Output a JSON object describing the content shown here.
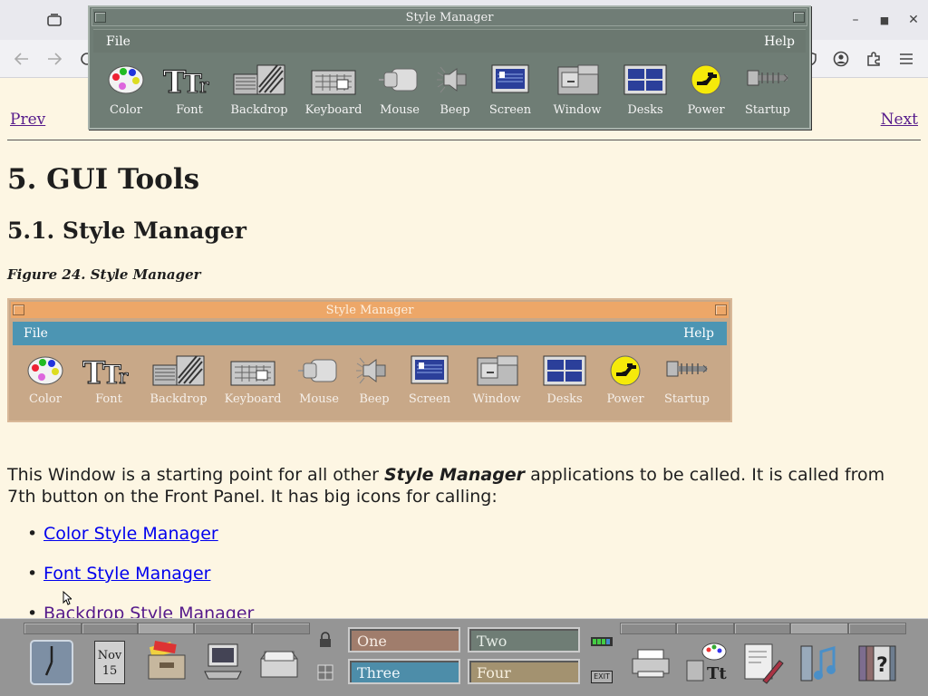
{
  "browser": {
    "window_controls": {
      "minimize": "–",
      "maximize": "■",
      "close": "✕"
    }
  },
  "page": {
    "nav": {
      "prev": "Prev",
      "next": "Next"
    },
    "heading1": "5. GUI Tools",
    "heading2": "5.1. Style Manager",
    "figure_caption": "Figure 24. Style Manager",
    "paragraph_pre": "This Window is a starting point for all other ",
    "paragraph_em": "Style Manager",
    "paragraph_post": " applications to be called. It is called from 7th button on the Front Panel. It has big icons for calling:",
    "links": [
      "Color Style Manager",
      "Font Style Manager",
      "Backdrop Style Manager"
    ]
  },
  "style_manager_window": {
    "title": "Style Manager",
    "menu": {
      "file": "File",
      "help": "Help"
    },
    "icons": [
      "Color",
      "Font",
      "Backdrop",
      "Keyboard",
      "Mouse",
      "Beep",
      "Screen",
      "Window",
      "Desks",
      "Power",
      "Startup"
    ]
  },
  "figure_window": {
    "title": "Style Manager",
    "menu": {
      "file": "File",
      "help": "Help"
    },
    "icons": [
      "Color",
      "Font",
      "Backdrop",
      "Keyboard",
      "Mouse",
      "Beep",
      "Screen",
      "Window",
      "Desks",
      "Power",
      "Startup"
    ]
  },
  "front_panel": {
    "workspaces": [
      "One",
      "Two",
      "Three",
      "Four"
    ],
    "calendar": {
      "month": "Nov",
      "day": "15"
    },
    "exit_label": "EXIT",
    "left_icons": [
      "clock-icon",
      "calendar-icon",
      "file-manager-icon",
      "terminal-icon",
      "mailer-icon"
    ],
    "right_icons": [
      "printer-icon",
      "style-manager-icon",
      "text-editor-icon",
      "audio-icon",
      "help-icon"
    ]
  },
  "colors": {
    "page_bg": "#fdf6e3",
    "sm_frame": "#6f7d75",
    "fig_title": "#e8a064",
    "fig_menu": "#4c95b3",
    "link": "#0000ee",
    "visited": "#551a8b"
  }
}
